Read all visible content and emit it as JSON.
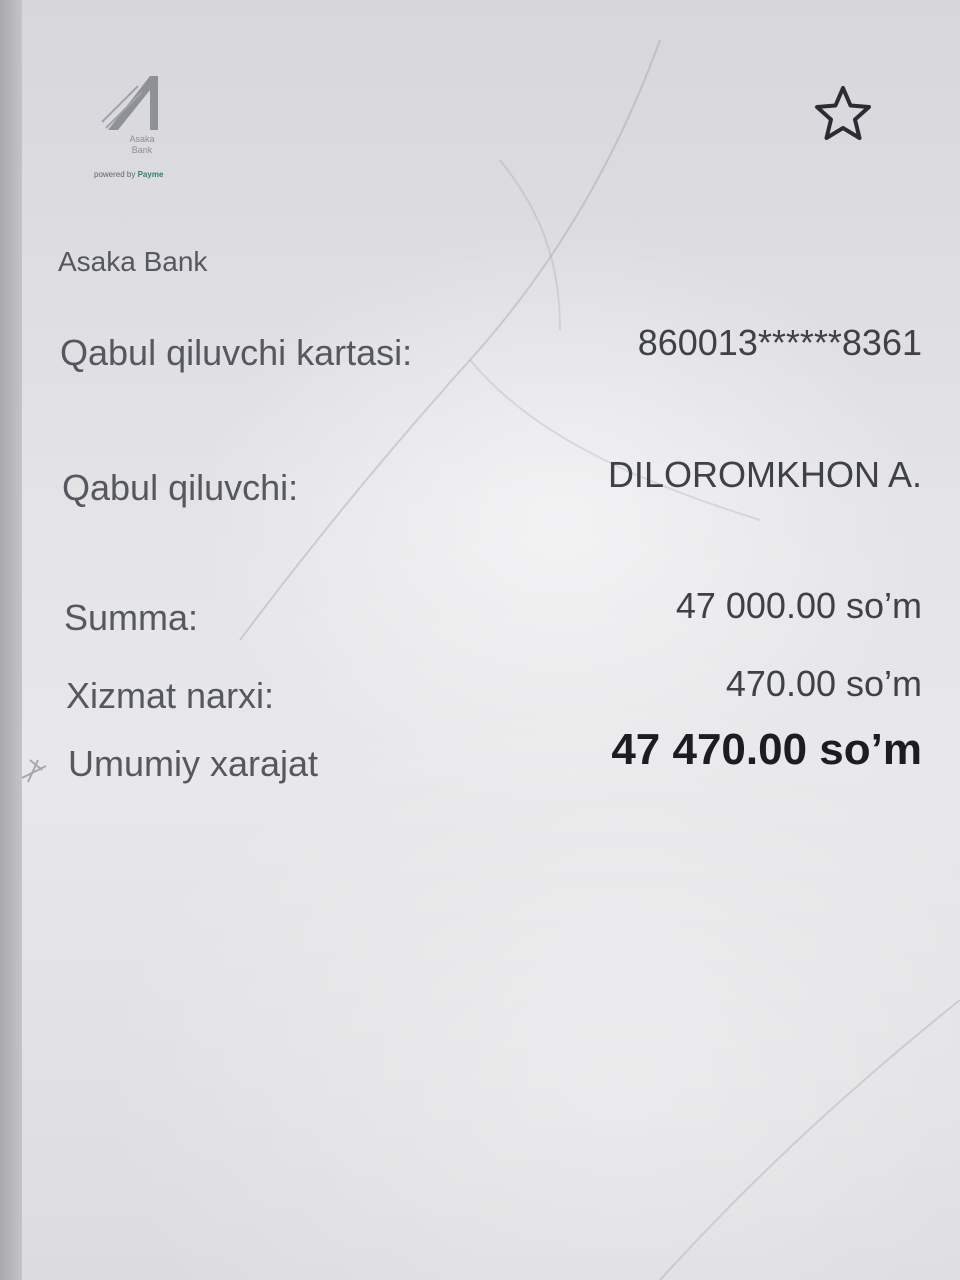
{
  "header": {
    "logo_icon": "asaka-bank-logo-icon",
    "logo_text_line1": "Asaka",
    "logo_text_line2": "Bank",
    "logo_sub_prefix": "powered by",
    "logo_sub_brand": "Payme",
    "favorite_icon": "star-outline-icon"
  },
  "bank_name": "Asaka Bank",
  "details": {
    "card_label": "Qabul qiluvchi kartasi:",
    "card_value": "860013******8361",
    "recipient_label": "Qabul qiluvchi:",
    "recipient_value": "DILOROMKHON A.",
    "amount_label": "Summa:",
    "amount_value": "47 000.00 so’m",
    "fee_label": "Xizmat narxi:",
    "fee_value": "470.00 so’m",
    "total_label": "Umumiy xarajat",
    "total_value": "47 470.00 so’m"
  },
  "colors": {
    "text_primary": "#1c1d21",
    "text_secondary": "#55585f",
    "accent_brand": "#2f7f6f"
  }
}
